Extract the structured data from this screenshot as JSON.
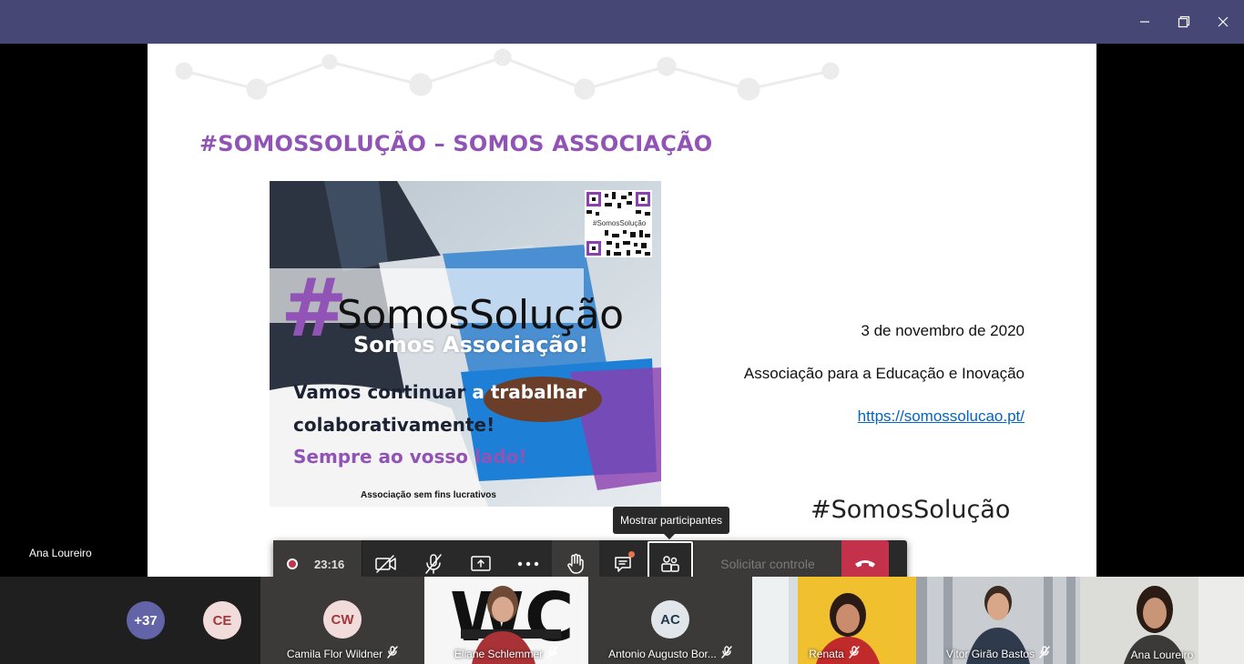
{
  "window": {
    "minimize_icon": "minimize-icon",
    "maximize_icon": "restore-icon",
    "close_icon": "close-icon"
  },
  "slide": {
    "title": "#SOMOSSOLUÇÃO – SOMOS ASSOCIAÇÃO",
    "photo": {
      "hashtag": "#",
      "headline": "SomosSolução",
      "subheadline": "Somos Associação!",
      "line1_a": "Vamos continuar ",
      "line1_b": "a trabalhar",
      "line2_a": "colaborativamente",
      "line2_b": "!",
      "line3": "Sempre ao vosso lado!",
      "footer": "Associação sem fins lucrativos",
      "qr_label": "#SomosSolução"
    },
    "date": "3 de novembro de 2020",
    "organization": "Associação para a Educação e Inovação",
    "url": "https://somossolucao.pt/",
    "brand": "#SomosSolução"
  },
  "presenter_name": "Ana Loureiro",
  "controls": {
    "recording_time": "23:16",
    "request_control": "Solicitar controle",
    "tooltip": "Mostrar participantes"
  },
  "colors": {
    "titlebar": "#464775",
    "accent_purple": "#9153b5",
    "hangup": "#c4314b"
  },
  "participants": {
    "more_count": "+37",
    "ce_initials": "CE",
    "tiles": [
      {
        "initials": "CW",
        "name": "Camila Flor Wildner"
      },
      {
        "name": "Eliane Schlemmer"
      },
      {
        "initials": "AC",
        "name": "Antonio Augusto Bor..."
      },
      {
        "name": "Renata"
      },
      {
        "name": "Vitor Girão Bastos"
      },
      {
        "name": "Ana Loureiro"
      }
    ]
  }
}
